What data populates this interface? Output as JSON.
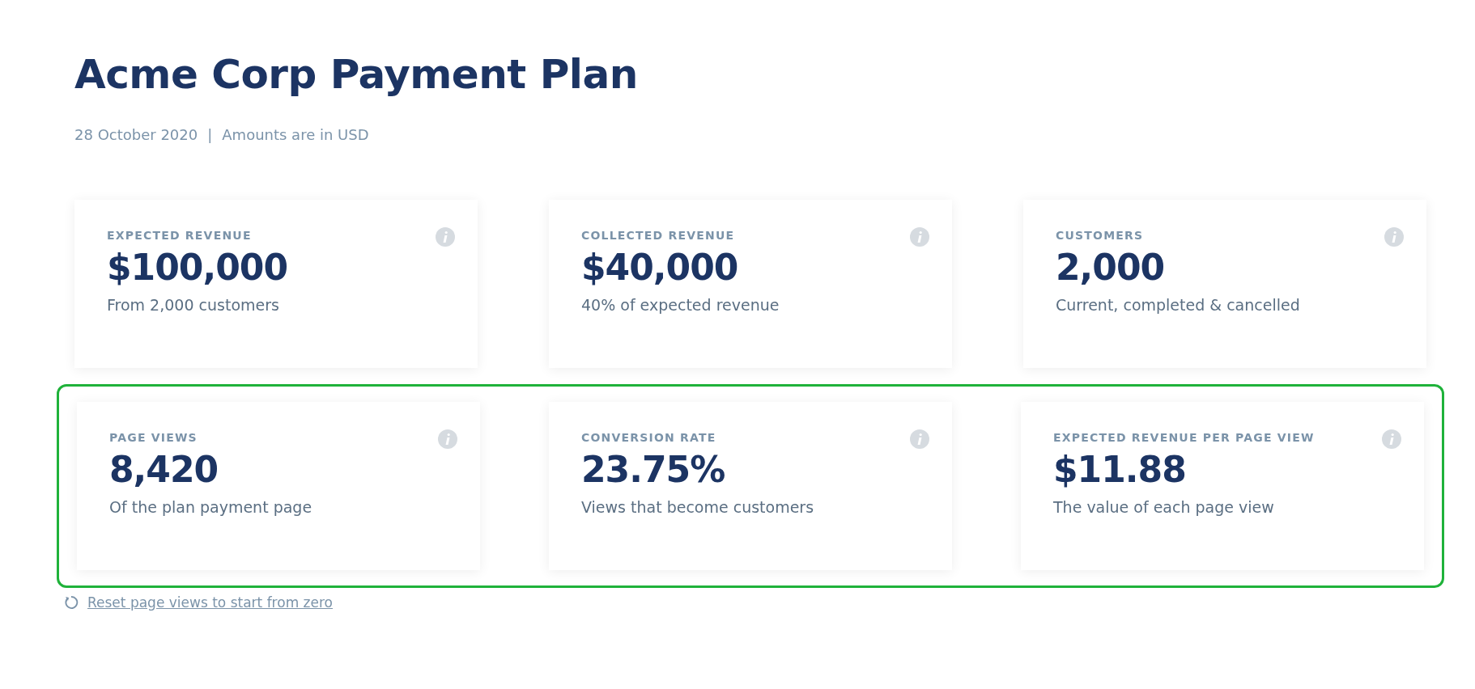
{
  "header": {
    "title": "Acme Corp Payment Plan",
    "date": "28 October 2020",
    "separator": "|",
    "note": "Amounts are in USD"
  },
  "card_rows": [
    {
      "highlighted": false,
      "cards": [
        {
          "label": "EXPECTED REVENUE",
          "value": "$100,000",
          "caption": "From 2,000 customers"
        },
        {
          "label": "COLLECTED REVENUE",
          "value": "$40,000",
          "caption": "40% of expected revenue"
        },
        {
          "label": "CUSTOMERS",
          "value": "2,000",
          "caption": "Current, completed & cancelled"
        }
      ]
    },
    {
      "highlighted": true,
      "cards": [
        {
          "label": "PAGE VIEWS",
          "value": "8,420",
          "caption": "Of the plan payment page"
        },
        {
          "label": "CONVERSION RATE",
          "value": "23.75%",
          "caption": "Views that become customers"
        },
        {
          "label": "EXPECTED REVENUE PER PAGE VIEW",
          "value": "$11.88",
          "caption": "The value of each page view"
        }
      ]
    }
  ],
  "reset_link": {
    "label": "Reset page views to start from zero"
  }
}
